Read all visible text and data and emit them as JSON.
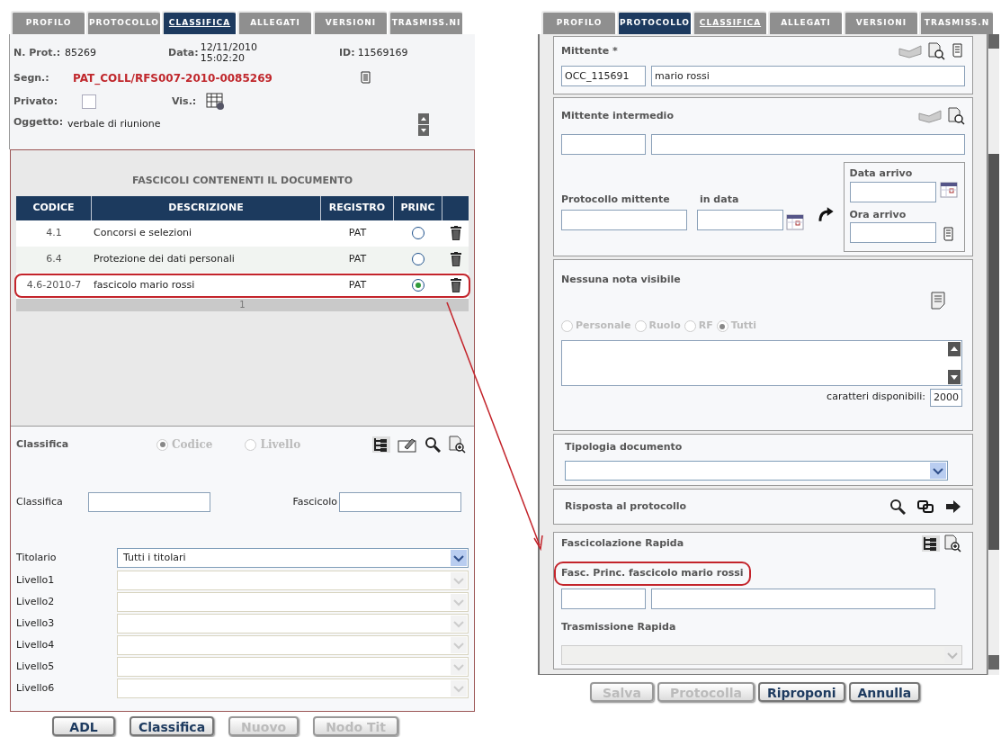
{
  "left": {
    "tabs": [
      {
        "label": "PROFILO",
        "selected": false,
        "link": false
      },
      {
        "label": "PROTOCOLLO",
        "selected": false,
        "link": false
      },
      {
        "label": "CLASSIFICA",
        "selected": true,
        "link": true
      },
      {
        "label": "ALLEGATI",
        "selected": false,
        "link": false
      },
      {
        "label": "VERSIONI",
        "selected": false,
        "link": false
      },
      {
        "label": "TRASMISS.NI",
        "selected": false,
        "link": false
      }
    ],
    "n_prot": {
      "label": "N. Prot.:",
      "value": "85269"
    },
    "data": {
      "label": "Data:",
      "date": "12/11/2010",
      "time": "15:02:20"
    },
    "id": {
      "label": "ID:",
      "value": "11569169"
    },
    "segnatura": {
      "label": "Segn.:",
      "value": "PAT_COLL/RFS007-2010-0085269"
    },
    "privato": {
      "label": "Privato:",
      "checked": false
    },
    "vis": {
      "label": "Vis.:"
    },
    "oggetto": {
      "label": "Oggetto:",
      "value": "verbale di riunione"
    },
    "fascicoli": {
      "title": "FASCICOLI CONTENENTI IL DOCUMENTO",
      "columns": [
        "CODICE",
        "DESCRIZIONE",
        "REGISTRO",
        "PRINC"
      ],
      "rows": [
        {
          "codice": "4.1",
          "descrizione": "Concorsi e selezioni",
          "registro": "PAT",
          "selected": false,
          "highlighted": false
        },
        {
          "codice": "6.4",
          "descrizione": "Protezione dei dati personali",
          "registro": "PAT",
          "selected": false,
          "highlighted": false
        },
        {
          "codice": "4.6-2010-7",
          "descrizione": "fascicolo mario rossi",
          "registro": "PAT",
          "selected": true,
          "highlighted": true
        }
      ],
      "pager": "1"
    },
    "classifica_form": {
      "label": "Classifica",
      "modes": [
        {
          "label": "Codice",
          "selected": true
        },
        {
          "label": "Livello",
          "selected": false
        }
      ],
      "classifica_label": "Classifica",
      "fascicolo_label": "Fascicolo"
    },
    "titolario": {
      "label": "Titolario",
      "value": "Tutti i titolari"
    },
    "livelli": [
      {
        "label": "Livello1",
        "disabled": true
      },
      {
        "label": "Livello2",
        "disabled": true
      },
      {
        "label": "Livello3",
        "disabled": true
      },
      {
        "label": "Livello4",
        "disabled": true
      },
      {
        "label": "Livello5",
        "disabled": true
      },
      {
        "label": "Livello6",
        "disabled": true
      }
    ],
    "buttons": [
      {
        "label": "ADL",
        "disabled": false
      },
      {
        "label": "Classifica",
        "disabled": false
      },
      {
        "label": "Nuovo",
        "disabled": true
      },
      {
        "label": "Nodo Tit",
        "disabled": true
      }
    ]
  },
  "right": {
    "tabs": [
      {
        "label": "PROFILO",
        "selected": false,
        "link": false
      },
      {
        "label": "PROTOCOLLO",
        "selected": true,
        "link": false
      },
      {
        "label": "CLASSIFICA",
        "selected": false,
        "link": true
      },
      {
        "label": "ALLEGATI",
        "selected": false,
        "link": false
      },
      {
        "label": "VERSIONI",
        "selected": false,
        "link": false
      },
      {
        "label": "TRASMISS.N",
        "selected": false,
        "link": false
      }
    ],
    "mittente": {
      "title": "Mittente *",
      "code": "OCC_115691",
      "name": "mario rossi"
    },
    "mittente_intermedio": {
      "title": "Mittente intermedio"
    },
    "protocollo_mittente": {
      "label": "Protocollo mittente"
    },
    "in_data": {
      "label": "in data"
    },
    "data_arrivo": {
      "label": "Data arrivo"
    },
    "ora_arrivo": {
      "label": "Ora arrivo"
    },
    "note": {
      "title": "Nessuna nota visibile",
      "visibility": [
        {
          "label": "Personale",
          "selected": false
        },
        {
          "label": "Ruolo",
          "selected": false
        },
        {
          "label": "RF",
          "selected": false
        },
        {
          "label": "Tutti",
          "selected": true
        }
      ],
      "counter_label": "caratteri disponibili:",
      "counter": "2000"
    },
    "tipologia": {
      "title": "Tipologia documento"
    },
    "risposta": {
      "title": "Risposta al protocollo"
    },
    "fascicolazione": {
      "title": "Fascicolazione Rapida",
      "principal": "Fasc. Princ. fascicolo mario rossi",
      "highlighted": true
    },
    "trasmissione": {
      "title": "Trasmissione Rapida"
    },
    "buttons": [
      {
        "label": "Salva",
        "disabled": true
      },
      {
        "label": "Protocolla",
        "disabled": true
      },
      {
        "label": "Riproponi",
        "disabled": false
      },
      {
        "label": "Annulla",
        "disabled": false
      }
    ]
  },
  "annotation_arrow": true
}
